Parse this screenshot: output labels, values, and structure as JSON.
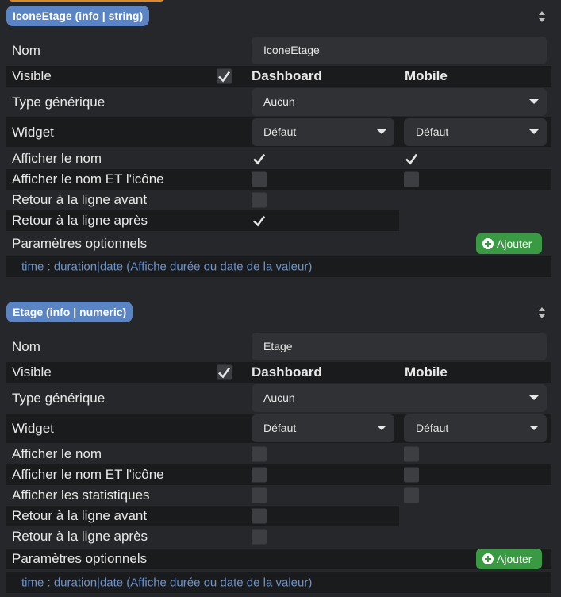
{
  "sections": [
    {
      "badge": "IconeEtage (info | string)",
      "nom_label": "Nom",
      "nom_value": "IconeEtage",
      "visible_label": "Visible",
      "col_dashboard": "Dashboard",
      "col_mobile": "Mobile",
      "type_label": "Type générique",
      "type_value": "Aucun",
      "widget_label": "Widget",
      "widget_dashboard": "Défaut",
      "widget_mobile": "Défaut",
      "rows": [
        {
          "label": "Afficher le nom",
          "dash": true,
          "mobile": true
        },
        {
          "label": "Afficher le nom ET l'icône",
          "dash": false,
          "mobile": false
        },
        {
          "label": "Retour à la ligne avant",
          "dash": false
        },
        {
          "label": "Retour à la ligne après",
          "dash": true
        }
      ],
      "params_label": "Paramètres optionnels",
      "add_label": "Ajouter",
      "param_text": "time : duration|date (Affiche durée ou date de la valeur)"
    },
    {
      "badge": "Etage (info | numeric)",
      "nom_label": "Nom",
      "nom_value": "Etage",
      "visible_label": "Visible",
      "col_dashboard": "Dashboard",
      "col_mobile": "Mobile",
      "type_label": "Type générique",
      "type_value": "Aucun",
      "widget_label": "Widget",
      "widget_dashboard": "Défaut",
      "widget_mobile": "Défaut",
      "rows": [
        {
          "label": "Afficher le nom",
          "dash": false,
          "mobile": false
        },
        {
          "label": "Afficher le nom ET l'icône",
          "dash": false,
          "mobile": false
        },
        {
          "label": "Afficher les statistiques",
          "dash": false,
          "mobile": false
        },
        {
          "label": "Retour à la ligne avant",
          "dash": false
        },
        {
          "label": "Retour à la ligne après",
          "dash": false
        }
      ],
      "params_label": "Paramètres optionnels",
      "add_label": "Ajouter",
      "param_text": "time : duration|date (Affiche durée ou date de la valeur)"
    }
  ]
}
